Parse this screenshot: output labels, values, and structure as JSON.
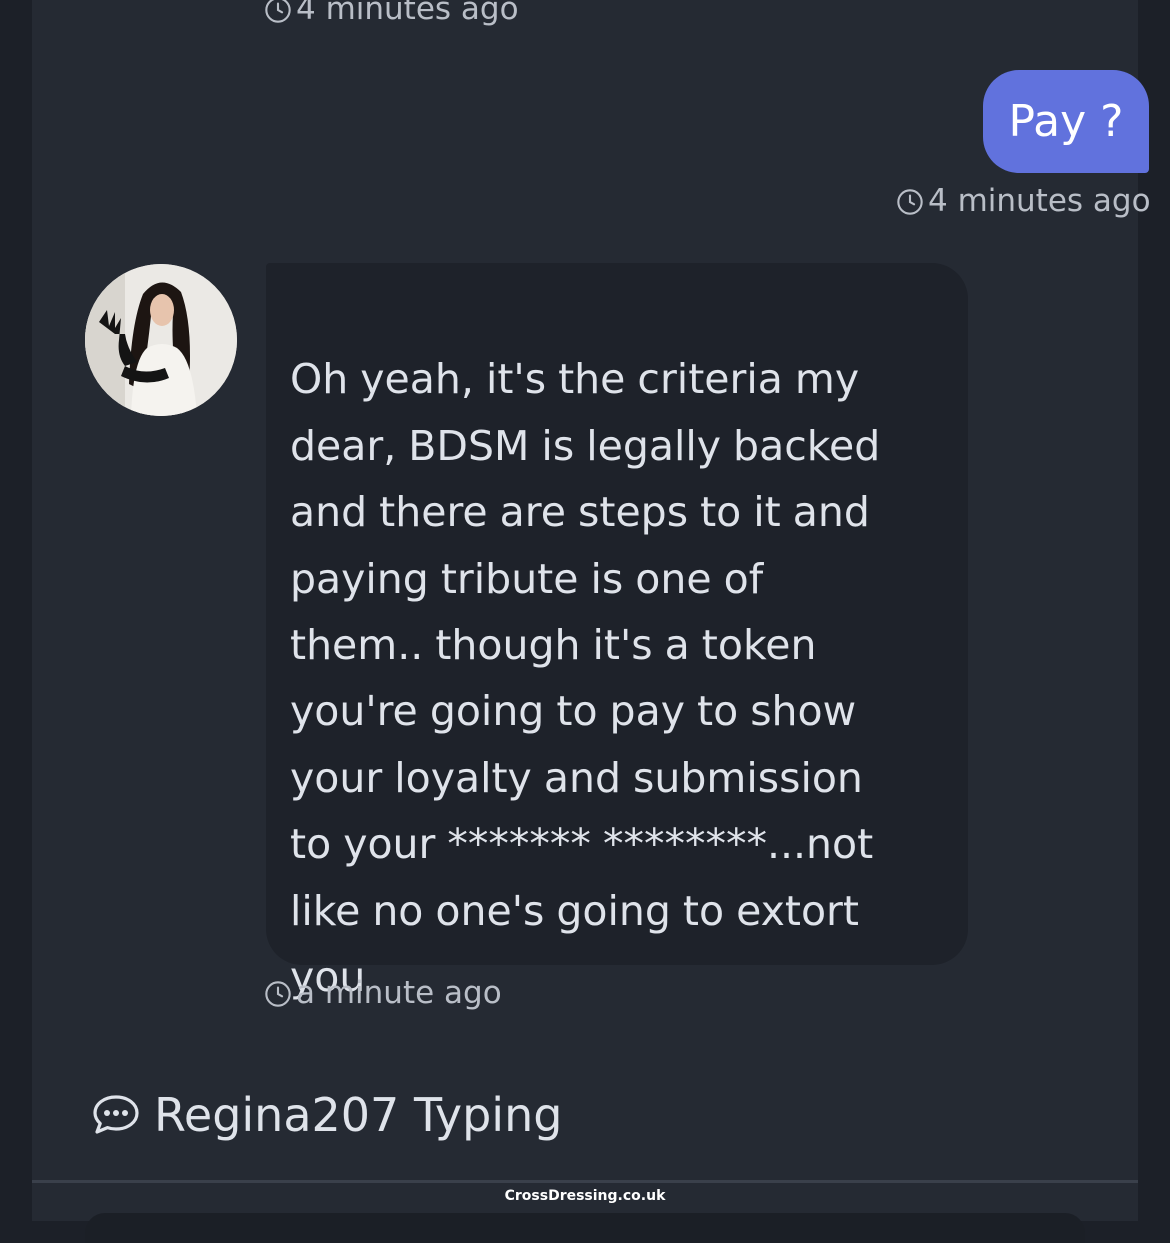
{
  "chat": {
    "prev_timestamp": "4 minutes ago",
    "sent_message": {
      "text": "Pay ?",
      "timestamp": "4 minutes ago",
      "bubble_color": "#6172dd"
    },
    "received_message": {
      "text": "Oh yeah, it's the criteria my\ndear, BDSM is legally backed\nand there are steps to it and\npaying tribute is one of\nthem.. though it's a token\nyou're going to pay to show\nyour loyalty and submission\nto your ******* ********...not\nlike no one's going to extort\nyou",
      "timestamp": "a minute ago",
      "bubble_color": "#1e222a"
    },
    "typing_indicator": "Regina207 Typing",
    "clock_icon": "clock-icon",
    "typing_icon": "chat-bubble-icon"
  },
  "watermark": "CrossDressing.co.uk",
  "colors": {
    "page_bg": "#1c2028",
    "panel_bg": "#252a33",
    "text": "#dfe3ea",
    "muted_text": "#b9bec7"
  }
}
